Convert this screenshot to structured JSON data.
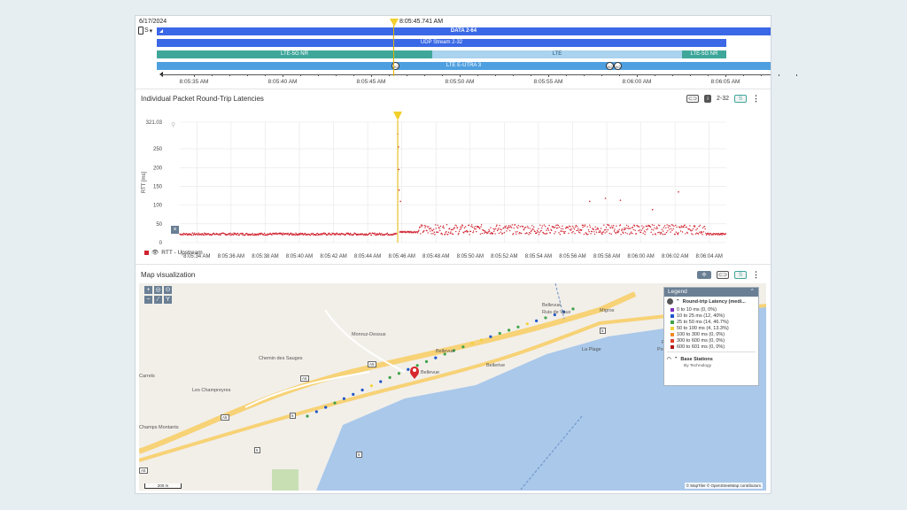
{
  "timeline": {
    "date": "6/17/2024",
    "cursor_time": "8:05:45.741 AM",
    "device_label": "S",
    "bars": {
      "data": "DATA 2-64",
      "udp": "UDP Stream 2-32",
      "lte5g_1": "LTE-5G NR",
      "lte": "LTE",
      "lte5g_2": "LTE-5G NR",
      "eutra": "LTE E-UTRA 3"
    },
    "handover_label": "HO",
    "axis_labels": [
      "8:05:35 AM",
      "8:05:40 AM",
      "8:05:45 AM",
      "8:05:50 AM",
      "8:05:55 AM",
      "8:06:00 AM",
      "8:06:05 AM"
    ]
  },
  "chart_panel": {
    "title": "Individual Packet Round-Trip Latencies",
    "link_icon": "link-icon",
    "badge": "2-32",
    "device_badge": "S",
    "legend_series": "RTT - Upstream",
    "reset_label": "×"
  },
  "chart_data": {
    "type": "scatter",
    "ylabel": "RTT [ms]",
    "ylim": [
      0,
      321.03
    ],
    "y_ticks": [
      "321.03",
      "250",
      "200",
      "150",
      "100",
      "50",
      "0"
    ],
    "x_ticks": [
      "8:05:34 AM",
      "8:05:36 AM",
      "8:05:38 AM",
      "8:05:40 AM",
      "8:05:42 AM",
      "8:05:44 AM",
      "8:05:46 AM",
      "8:05:48 AM",
      "8:05:50 AM",
      "8:05:52 AM",
      "8:05:54 AM",
      "8:05:56 AM",
      "8:05:58 AM",
      "8:06:00 AM",
      "8:06:02 AM",
      "8:06:04 AM"
    ],
    "series": [
      {
        "name": "RTT - Upstream",
        "color": "#d0202e"
      }
    ],
    "segments": [
      {
        "x_start": 0.0,
        "x_end": 31.8,
        "y_base": 22,
        "y_jitter": 6
      },
      {
        "x_start": 32.2,
        "x_end": 35.0,
        "y_base": 28,
        "y_jitter": 5
      },
      {
        "x_start": 35.0,
        "x_end": 77.0,
        "y_base": 32,
        "y_jitter": 22
      },
      {
        "x_start": 77.0,
        "x_end": 80.0,
        "y_base": 22,
        "y_jitter": 5
      }
    ],
    "spikes": [
      [
        31.9,
        290
      ],
      [
        32.0,
        255
      ],
      [
        32.05,
        195
      ],
      [
        32.1,
        140
      ],
      [
        32.3,
        110
      ],
      [
        60.0,
        110
      ],
      [
        62.3,
        118
      ],
      [
        64.5,
        113
      ],
      [
        73.0,
        135
      ],
      [
        69.2,
        88
      ]
    ],
    "cursor_x": 31.9
  },
  "map_panel": {
    "title": "Map visualization",
    "labels": [
      "Bellevue",
      "Bellevue",
      "Bellerive",
      "Migros",
      "La Plage",
      "Ruis de Vaux",
      "Port Ruis",
      "Les Champreyres",
      "Chemin des Sauges",
      "Monruz-Dessus",
      "Carrels",
      "Champs Montants",
      "Bellevue",
      "Port"
    ],
    "road_labels": [
      "A5",
      "A5",
      "A5",
      "A5",
      "5",
      "5",
      "5",
      "5"
    ],
    "scale_label": "200 m",
    "attribution": "© MapTiler © OpenStreetMap contributors",
    "legend": {
      "title": "Legend",
      "section_latency": "Round-trip Latency (medi...",
      "rows": [
        {
          "label": "0 to 10 ms (0, 0%)",
          "color": "#7b2fbf"
        },
        {
          "label": "10 to 25 ms (12, 40%)",
          "color": "#2057c9"
        },
        {
          "label": "25 to 50 ms (14, 46.7%)",
          "color": "#3fa24a"
        },
        {
          "label": "50 to 100 ms (4, 13.3%)",
          "color": "#f3d23a"
        },
        {
          "label": "100 to 300 ms (0, 0%)",
          "color": "#f08a24"
        },
        {
          "label": "300 to 600 ms (0, 0%)",
          "color": "#e0402a"
        },
        {
          "label": "600 to 601 ms (0, 0%)",
          "color": "#b01818"
        }
      ],
      "section_stations": "Base Stations",
      "stations_sub": "By Technology"
    }
  },
  "colors": {
    "accent": "#3a68e6",
    "teal": "#3fa79a",
    "cursor": "#f2cf2b",
    "point": "#d0202e",
    "water": "#a9c8ea"
  }
}
